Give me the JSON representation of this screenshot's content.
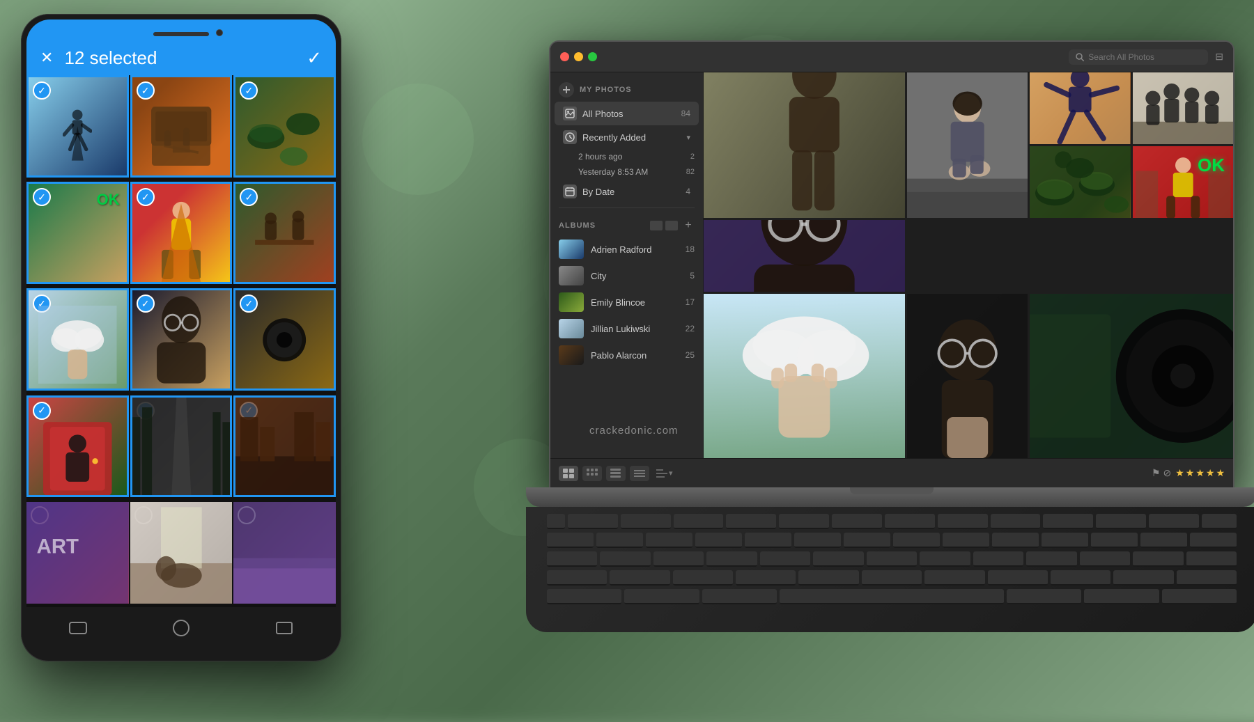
{
  "background": {
    "color": "#6b8a6b"
  },
  "phone": {
    "topbar": {
      "selected_count": "12 selected"
    },
    "photos": [
      {
        "id": 1,
        "selected": true,
        "color_class": "photo-1"
      },
      {
        "id": 2,
        "selected": true,
        "color_class": "photo-2"
      },
      {
        "id": 3,
        "selected": true,
        "color_class": "photo-3"
      },
      {
        "id": 4,
        "selected": true,
        "color_class": "photo-4"
      },
      {
        "id": 5,
        "selected": true,
        "color_class": "photo-5"
      },
      {
        "id": 6,
        "selected": true,
        "color_class": "photo-6"
      },
      {
        "id": 7,
        "selected": true,
        "color_class": "photo-7"
      },
      {
        "id": 8,
        "selected": true,
        "color_class": "photo-8"
      },
      {
        "id": 9,
        "selected": true,
        "color_class": "photo-9"
      },
      {
        "id": 10,
        "selected": true,
        "color_class": "photo-10"
      },
      {
        "id": 11,
        "selected": true,
        "color_class": "photo-11"
      },
      {
        "id": 12,
        "selected": true,
        "color_class": "photo-12"
      },
      {
        "id": 13,
        "selected": false,
        "color_class": "photo-13"
      },
      {
        "id": 14,
        "selected": false,
        "color_class": "photo-14"
      },
      {
        "id": 15,
        "selected": false,
        "color_class": "photo-15"
      }
    ]
  },
  "laptop": {
    "app": {
      "toolbar": {
        "search_placeholder": "Search All Photos",
        "traffic_lights": [
          "red",
          "yellow",
          "green"
        ]
      },
      "sidebar": {
        "my_photos_label": "MY PHOTOS",
        "all_photos": {
          "label": "All Photos",
          "count": "84"
        },
        "recently_added": {
          "label": "Recently Added",
          "sub_items": [
            {
              "label": "2 hours ago",
              "count": "2"
            },
            {
              "label": "Yesterday 8:53 AM",
              "count": "82"
            }
          ]
        },
        "by_date": {
          "label": "By Date",
          "count": "4"
        },
        "albums_label": "ALBUMS",
        "albums": [
          {
            "name": "Adrien Radford",
            "count": "18"
          },
          {
            "name": "City",
            "count": "5"
          },
          {
            "name": "Emily Blincoe",
            "count": "17"
          },
          {
            "name": "Jillian Lukiwski",
            "count": "22"
          },
          {
            "name": "Pablo Alarcon",
            "count": "25"
          }
        ]
      },
      "bottom_toolbar": {
        "view_options": [
          "grid-large",
          "grid-medium",
          "grid-small",
          "list"
        ],
        "stars": [
          "★",
          "★",
          "★",
          "★",
          "★"
        ]
      }
    }
  },
  "watermark": "crackedonic.com"
}
